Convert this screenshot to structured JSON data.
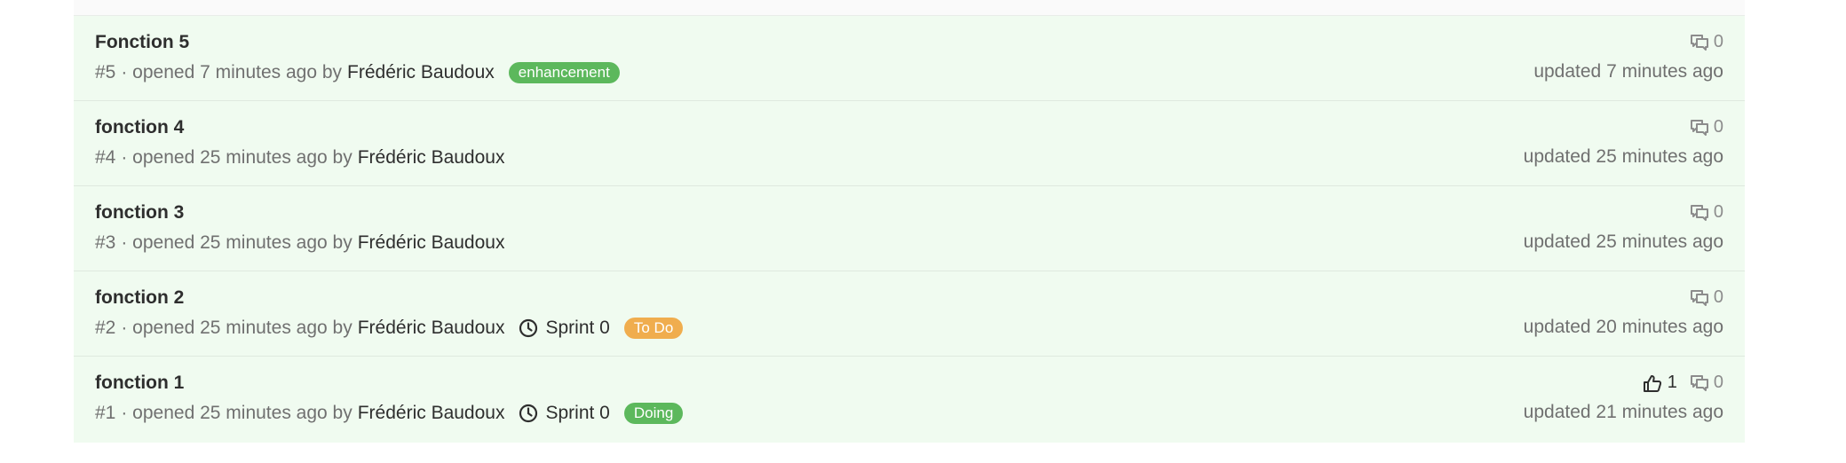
{
  "issues": [
    {
      "title": "Fonction 5",
      "ref": "#5",
      "opened": "· opened 7 minutes ago by",
      "author": "Frédéric Baudoux",
      "milestone": "",
      "label": "enhancement",
      "label_color": "#5cb85c",
      "upvotes": "",
      "comments": "0",
      "updated": "updated 7 minutes ago"
    },
    {
      "title": "fonction 4",
      "ref": "#4",
      "opened": "· opened 25 minutes ago by",
      "author": "Frédéric Baudoux",
      "milestone": "",
      "label": "",
      "label_color": "",
      "upvotes": "",
      "comments": "0",
      "updated": "updated 25 minutes ago"
    },
    {
      "title": "fonction 3",
      "ref": "#3",
      "opened": "· opened 25 minutes ago by",
      "author": "Frédéric Baudoux",
      "milestone": "",
      "label": "",
      "label_color": "",
      "upvotes": "",
      "comments": "0",
      "updated": "updated 25 minutes ago"
    },
    {
      "title": "fonction 2",
      "ref": "#2",
      "opened": "· opened 25 minutes ago by",
      "author": "Frédéric Baudoux",
      "milestone": "Sprint 0",
      "label": "To Do",
      "label_color": "#f0ad4e",
      "upvotes": "",
      "comments": "0",
      "updated": "updated 20 minutes ago"
    },
    {
      "title": "fonction 1",
      "ref": "#1",
      "opened": "· opened 25 minutes ago by",
      "author": "Frédéric Baudoux",
      "milestone": "Sprint 0",
      "label": "Doing",
      "label_color": "#5cb85c",
      "upvotes": "1",
      "comments": "0",
      "updated": "updated 21 minutes ago"
    }
  ],
  "icons": {
    "milestone": "clock-icon",
    "comments": "comments-icon",
    "upvote": "thumbs-up-icon"
  }
}
